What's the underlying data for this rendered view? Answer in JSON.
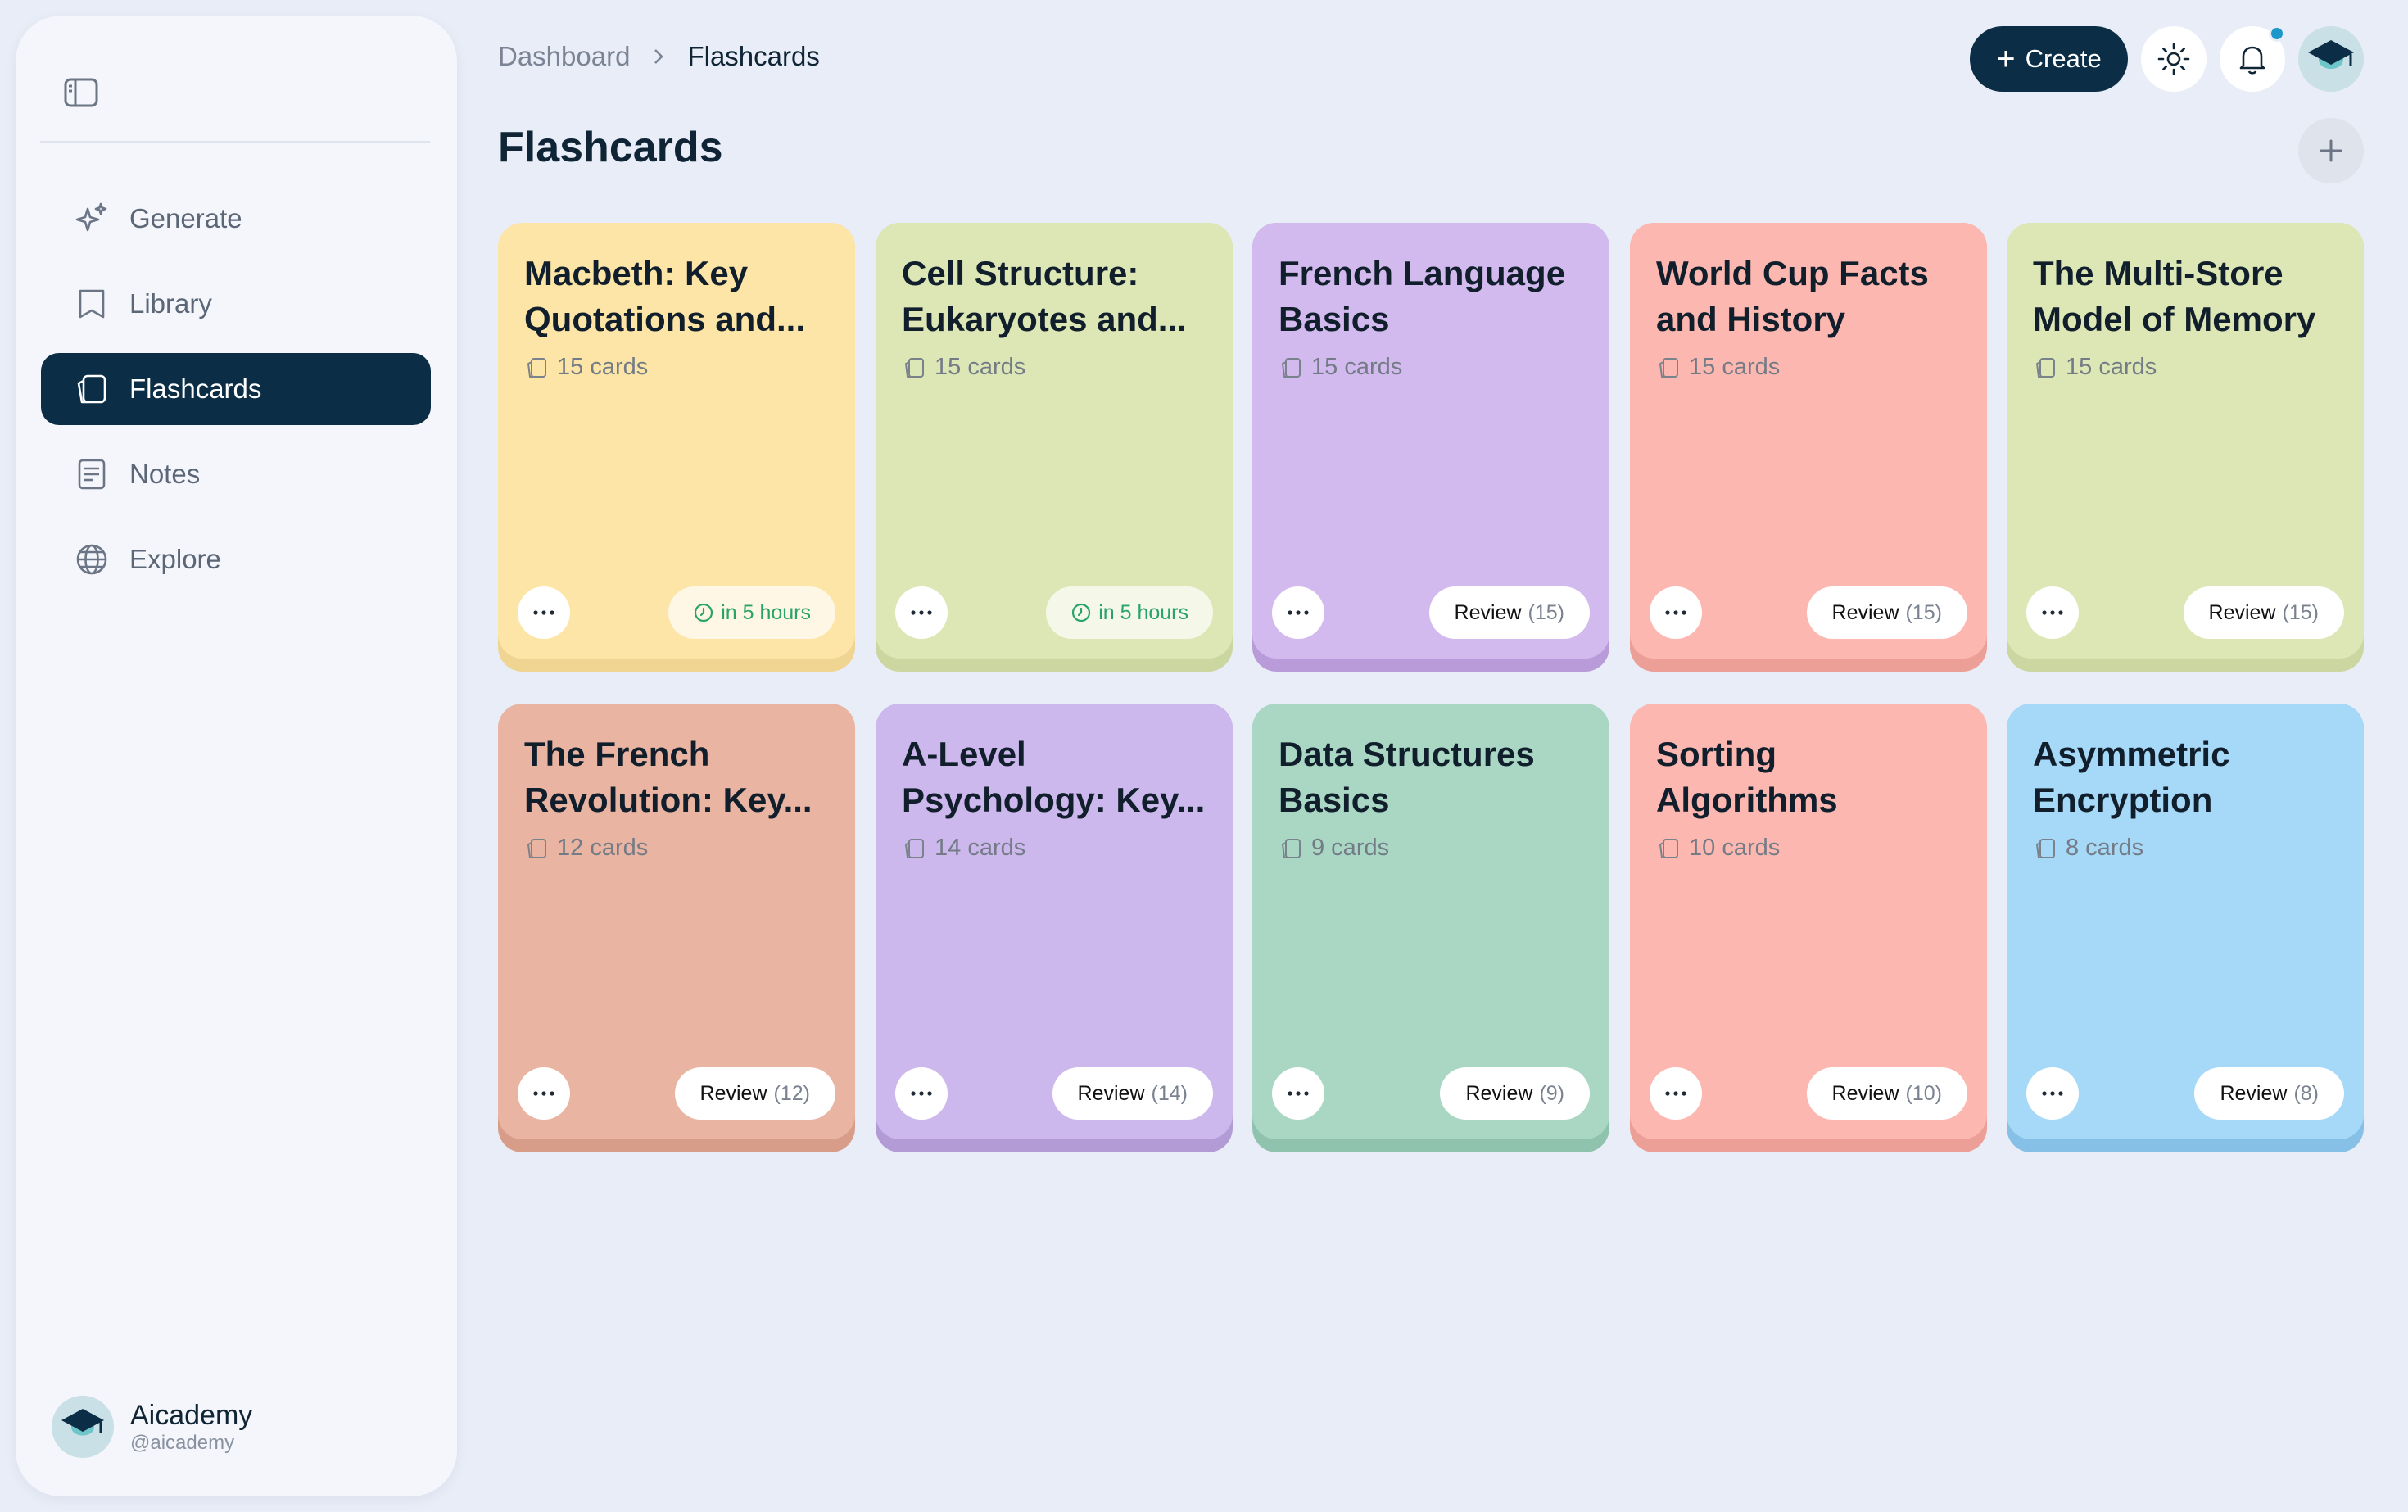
{
  "sidebar": {
    "items": [
      {
        "id": "generate",
        "label": "Generate",
        "icon": "sparkle-icon",
        "active": false
      },
      {
        "id": "library",
        "label": "Library",
        "icon": "bookmark-icon",
        "active": false
      },
      {
        "id": "flashcards",
        "label": "Flashcards",
        "icon": "cards-icon",
        "active": true
      },
      {
        "id": "notes",
        "label": "Notes",
        "icon": "notes-icon",
        "active": false
      },
      {
        "id": "explore",
        "label": "Explore",
        "icon": "globe-icon",
        "active": false
      }
    ],
    "user": {
      "name": "Aicademy",
      "handle": "@aicademy"
    }
  },
  "header": {
    "breadcrumb": [
      "Dashboard",
      "Flashcards"
    ],
    "create_label": "Create"
  },
  "page": {
    "title": "Flashcards"
  },
  "decks": [
    {
      "title": "Macbeth: Key Quotations and...",
      "count": "15 cards",
      "action": "in 5 hours",
      "due": true,
      "color": "#fde5a7",
      "shadow": "#f0d592"
    },
    {
      "title": "Cell Structure: Eukaryotes and...",
      "count": "15 cards",
      "action": "in 5 hours",
      "due": true,
      "color": "#dde6b5",
      "shadow": "#ccd6a0"
    },
    {
      "title": "French Language Basics",
      "count": "15 cards",
      "action": "Review",
      "review_count": "(15)",
      "due": false,
      "color": "#d2b9ee",
      "shadow": "#b89bd8"
    },
    {
      "title": "World Cup Facts and History",
      "count": "15 cards",
      "action": "Review",
      "review_count": "(15)",
      "due": false,
      "color": "#fcb8b0",
      "shadow": "#eb9f97"
    },
    {
      "title": "The Multi-Store Model of Memory",
      "count": "15 cards",
      "action": "Review",
      "review_count": "(15)",
      "due": false,
      "color": "#dde6b5",
      "shadow": "#ccd6a0"
    },
    {
      "title": "The French Revolution: Key...",
      "count": "12 cards",
      "action": "Review",
      "review_count": "(12)",
      "due": false,
      "color": "#e9b4a1",
      "shadow": "#d79d89"
    },
    {
      "title": "A-Level Psychology: Key...",
      "count": "14 cards",
      "action": "Review",
      "review_count": "(14)",
      "due": false,
      "color": "#ccb8ec",
      "shadow": "#b39cd6"
    },
    {
      "title": "Data Structures Basics",
      "count": "9 cards",
      "action": "Review",
      "review_count": "(9)",
      "due": false,
      "color": "#a9d7c4",
      "shadow": "#90c3ae"
    },
    {
      "title": "Sorting Algorithms",
      "count": "10 cards",
      "action": "Review",
      "review_count": "(10)",
      "due": false,
      "color": "#fcb8b0",
      "shadow": "#eb9f97"
    },
    {
      "title": "Asymmetric Encryption",
      "count": "8 cards",
      "action": "Review",
      "review_count": "(8)",
      "due": false,
      "color": "#a6d8f7",
      "shadow": "#86c0e6"
    }
  ],
  "colors": {
    "accent": "#0b2e46",
    "background": "#e9edf7",
    "due_green": "#29a36a",
    "notification": "#1d97c9"
  }
}
